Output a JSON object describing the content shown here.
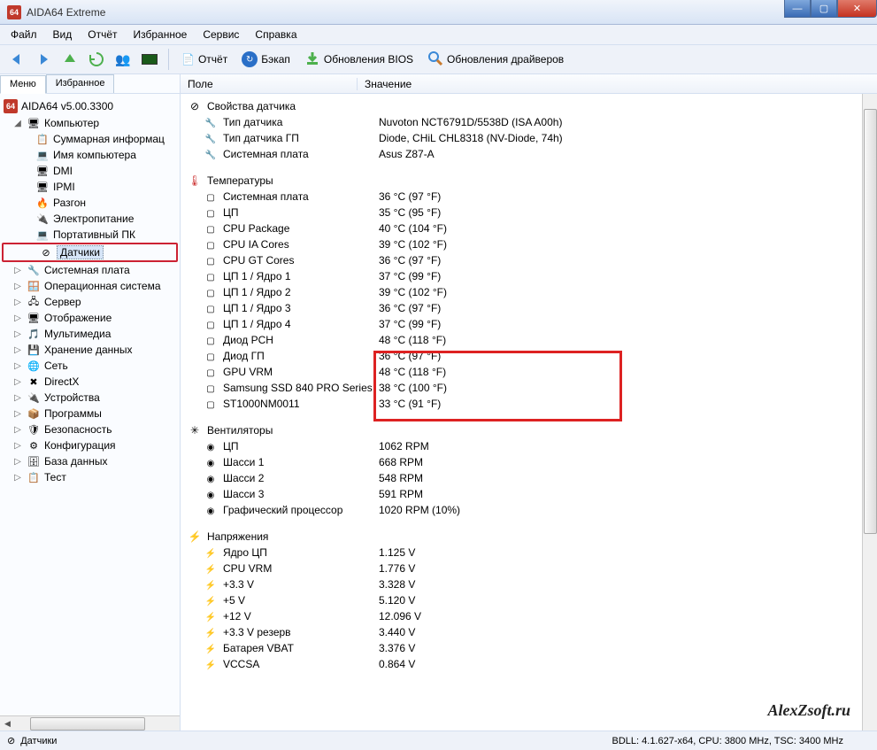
{
  "window": {
    "title": "AIDA64 Extreme",
    "icon_text": "64"
  },
  "menu": [
    "Файл",
    "Вид",
    "Отчёт",
    "Избранное",
    "Сервис",
    "Справка"
  ],
  "toolbar": {
    "report": "Отчёт",
    "backup": "Бэкап",
    "bios": "Обновления BIOS",
    "drivers": "Обновления драйверов"
  },
  "left_tabs": {
    "menu": "Меню",
    "fav": "Избранное"
  },
  "tree": {
    "root": "AIDA64 v5.00.3300",
    "computer": "Компьютер",
    "computer_children": [
      "Суммарная информац",
      "Имя компьютера",
      "DMI",
      "IPMI",
      "Разгон",
      "Электропитание",
      "Портативный ПК",
      "Датчики"
    ],
    "rest": [
      "Системная плата",
      "Операционная система",
      "Сервер",
      "Отображение",
      "Мультимедиа",
      "Хранение данных",
      "Сеть",
      "DirectX",
      "Устройства",
      "Программы",
      "Безопасность",
      "Конфигурация",
      "База данных",
      "Тест"
    ]
  },
  "columns": {
    "field": "Поле",
    "value": "Значение"
  },
  "sections": {
    "sensor_props": "Свойства датчика",
    "temps": "Температуры",
    "fans": "Вентиляторы",
    "volts": "Напряжения"
  },
  "sensor_props": [
    {
      "f": "Тип датчика",
      "v": "Nuvoton NCT6791D/5538D  (ISA A00h)"
    },
    {
      "f": "Тип датчика ГП",
      "v": "Diode, CHiL CHL8318  (NV-Diode, 74h)"
    },
    {
      "f": "Системная плата",
      "v": "Asus Z87-A"
    }
  ],
  "temps": [
    {
      "f": "Системная плата",
      "v": "36 °C  (97 °F)"
    },
    {
      "f": "ЦП",
      "v": "35 °C  (95 °F)"
    },
    {
      "f": "CPU Package",
      "v": "40 °C  (104 °F)"
    },
    {
      "f": "CPU IA Cores",
      "v": "39 °C  (102 °F)"
    },
    {
      "f": "CPU GT Cores",
      "v": "36 °C  (97 °F)"
    },
    {
      "f": "ЦП 1 / Ядро 1",
      "v": "37 °C  (99 °F)"
    },
    {
      "f": "ЦП 1 / Ядро 2",
      "v": "39 °C  (102 °F)"
    },
    {
      "f": "ЦП 1 / Ядро 3",
      "v": "36 °C  (97 °F)"
    },
    {
      "f": "ЦП 1 / Ядро 4",
      "v": "37 °C  (99 °F)"
    },
    {
      "f": "Диод PCH",
      "v": "48 °C  (118 °F)"
    },
    {
      "f": "Диод ГП",
      "v": "36 °C  (97 °F)"
    },
    {
      "f": "GPU VRM",
      "v": "48 °C  (118 °F)"
    },
    {
      "f": "Samsung SSD 840 PRO Series",
      "v": "38 °C  (100 °F)"
    },
    {
      "f": "ST1000NM0011",
      "v": "33 °C  (91 °F)"
    }
  ],
  "fans": [
    {
      "f": "ЦП",
      "v": "1062 RPM"
    },
    {
      "f": "Шасси 1",
      "v": "668 RPM"
    },
    {
      "f": "Шасси 2",
      "v": "548 RPM"
    },
    {
      "f": "Шасси 3",
      "v": "591 RPM"
    },
    {
      "f": "Графический процессор",
      "v": "1020 RPM  (10%)"
    }
  ],
  "volts": [
    {
      "f": "Ядро ЦП",
      "v": "1.125 V"
    },
    {
      "f": "CPU VRM",
      "v": "1.776 V"
    },
    {
      "f": "+3.3 V",
      "v": "3.328 V"
    },
    {
      "f": "+5 V",
      "v": "5.120 V"
    },
    {
      "f": "+12 V",
      "v": "12.096 V"
    },
    {
      "f": "+3.3 V резерв",
      "v": "3.440 V"
    },
    {
      "f": "Батарея VBAT",
      "v": "3.376 V"
    },
    {
      "f": "VCCSA",
      "v": "0.864 V"
    }
  ],
  "status": {
    "left": "Датчики",
    "right": "BDLL: 4.1.627-x64, CPU: 3800 MHz, TSC: 3400 MHz"
  },
  "watermark": "AlexZsoft.ru",
  "tree_icons": [
    "📋",
    "💻",
    "🖥",
    "🖥",
    "🔥",
    "🔌",
    "💻",
    "⊘",
    "🔧",
    "🪟",
    "🖥",
    "🖥",
    "🎵",
    "💾",
    "🌐",
    "✖",
    "🔌",
    "📦",
    "🛡",
    "⚙",
    "🗄",
    "📋"
  ]
}
